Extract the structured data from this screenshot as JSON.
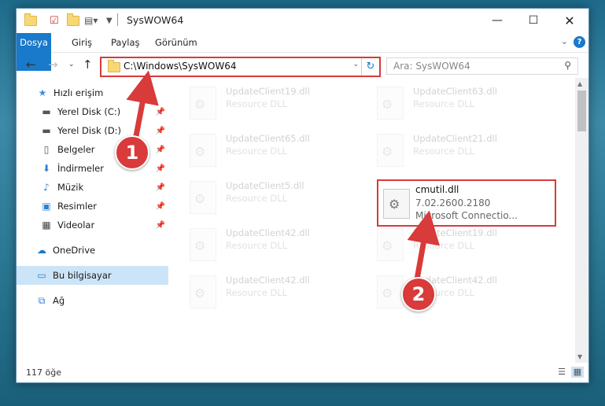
{
  "window": {
    "title": "SysWOW64"
  },
  "ribbon": {
    "tabs": [
      "Dosya",
      "Giriş",
      "Paylaş",
      "Görünüm"
    ],
    "help": "?"
  },
  "address": {
    "path": "C:\\Windows\\SysWOW64"
  },
  "search": {
    "placeholder": "Ara: SysWOW64"
  },
  "sidebar": {
    "items": [
      {
        "label": "Hızlı erişim",
        "icon": "star-icon"
      },
      {
        "label": "Yerel Disk (C:)",
        "icon": "drive-icon"
      },
      {
        "label": "Yerel Disk (D:)",
        "icon": "drive-icon"
      },
      {
        "label": "Belgeler",
        "icon": "documents-icon"
      },
      {
        "label": "İndirmeler",
        "icon": "download-icon"
      },
      {
        "label": "Müzik",
        "icon": "music-icon"
      },
      {
        "label": "Resimler",
        "icon": "pictures-icon"
      },
      {
        "label": "Videolar",
        "icon": "videos-icon"
      },
      {
        "label": "OneDrive",
        "icon": "cloud-icon"
      },
      {
        "label": "Bu bilgisayar",
        "icon": "computer-icon"
      },
      {
        "label": "Ağ",
        "icon": "network-icon"
      }
    ]
  },
  "files": [
    {
      "name": "UpdateClient19.dll",
      "desc": "Resource DLL"
    },
    {
      "name": "UpdateClient63.dll",
      "desc": "Resource DLL"
    },
    {
      "name": "UpdateClient65.dll",
      "desc": "Resource DLL"
    },
    {
      "name": "UpdateClient21.dll",
      "desc": "Resource DLL"
    },
    {
      "name": "UpdateClient5.dll",
      "desc": "Resource DLL"
    },
    {
      "name": "UpdateClient42.dll",
      "desc": "Resource DLL"
    },
    {
      "name": "UpdateClient19.dll",
      "desc": "Resource DLL"
    },
    {
      "name": "UpdateClient42.dll",
      "desc": "Resource DLL"
    },
    {
      "name": "UpdateClient42.dll",
      "desc": "Resource DLL"
    }
  ],
  "highlighted_file": {
    "name": "cmutil.dll",
    "version": "7.02.2600.2180",
    "company": "Microsoft Connectio..."
  },
  "status": {
    "count": "117 öğe"
  },
  "markers": [
    "1",
    "2"
  ],
  "colors": {
    "accent": "#1979ca",
    "highlight": "#d93a3a"
  }
}
